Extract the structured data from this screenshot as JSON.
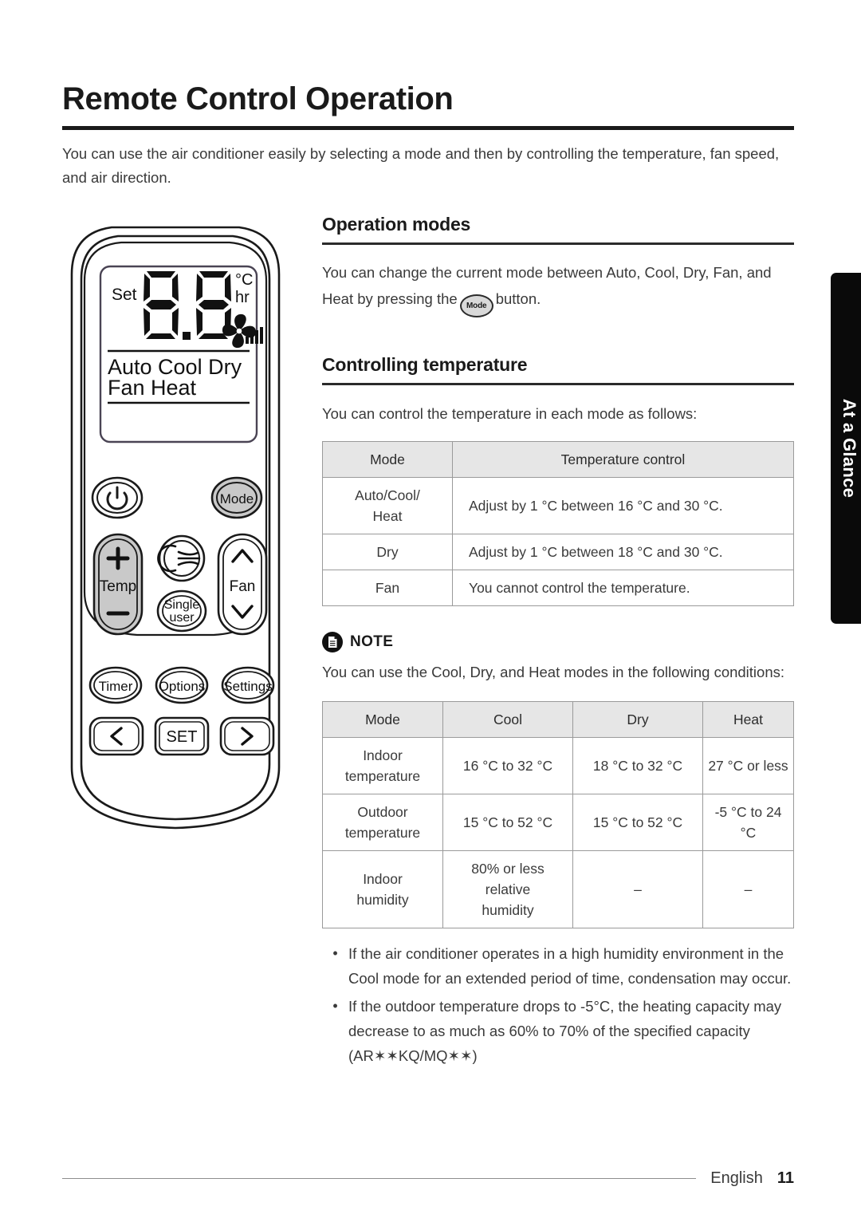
{
  "page": {
    "title": "Remote Control Operation",
    "intro": "You can use the air conditioner easily by selecting a mode and then by controlling the temperature, fan speed, and air direction."
  },
  "side_tab": {
    "label": "At a Glance"
  },
  "remote": {
    "display": {
      "set_label": "Set",
      "digits": "8.8",
      "unit_celsius": "°C",
      "unit_hour": "hr",
      "mode_line_1": "Auto Cool Dry",
      "mode_line_2": "Fan  Heat"
    },
    "buttons": {
      "power": "power-icon",
      "mode": "Mode",
      "temp": "Temp",
      "temp_plus": "+",
      "temp_minus": "−",
      "airflow": "airflow-icon",
      "single_user_line1": "Single",
      "single_user_line2": "user",
      "fan": "Fan",
      "timer": "Timer",
      "options": "Options",
      "settings": "Settings",
      "prev": "‹",
      "set": "SET",
      "next": "›"
    }
  },
  "sections": {
    "operation_modes": {
      "heading": "Operation modes",
      "text_before": "You can change the current mode between Auto, Cool, Dry, Fan, and Heat by pressing the",
      "inline_button": "Mode",
      "text_after": "button."
    },
    "controlling_temperature": {
      "heading": "Controlling temperature",
      "lead": "You can control the temperature in each mode as follows:"
    }
  },
  "table_temperature_control": {
    "headers": [
      "Mode",
      "Temperature control"
    ],
    "rows": [
      [
        "Auto/Cool/\nHeat",
        "Adjust by 1 °C between 16 °C and 30 °C."
      ],
      [
        "Dry",
        "Adjust by 1 °C between 18 °C and 30 °C."
      ],
      [
        "Fan",
        "You cannot control the temperature."
      ]
    ]
  },
  "note": {
    "icon": "document-icon",
    "label": "NOTE",
    "text": "You can use the Cool, Dry, and Heat modes in the following conditions:"
  },
  "table_conditions": {
    "headers": [
      "Mode",
      "Cool",
      "Dry",
      "Heat"
    ],
    "rows": [
      {
        "label": "Indoor\ntemperature",
        "cool": "16 °C to 32 °C",
        "dry": "18 °C to 32 °C",
        "heat": "27 °C or less"
      },
      {
        "label": "Outdoor\ntemperature",
        "cool": "15 °C to 52 °C",
        "dry": "15 °C to 52 °C",
        "heat": "-5 °C to 24 °C"
      },
      {
        "label": "Indoor\nhumidity",
        "cool": "80% or less\nrelative\nhumidity",
        "dry": "–",
        "heat": "–"
      }
    ]
  },
  "bullets": [
    {
      "marker": "•",
      "text": "If the air conditioner operates in a high humidity environment in the Cool mode for an extended period of time, condensation may occur."
    },
    {
      "marker": "•",
      "text": "If the outdoor temperature drops to -5°C, the heating capacity may decrease to as much as 60% to 70% of the specified capacity (AR✶✶KQ/MQ✶✶)"
    }
  ],
  "footer": {
    "language": "English",
    "page_number": "11"
  },
  "colors": {
    "ink": "#231f20",
    "rule": "#1a1a1a",
    "table_header_bg": "#e6e6e6",
    "table_border": "#9a9a9a",
    "tab_bg": "#0a0a0a",
    "button_gray": "#c9c9c9"
  }
}
